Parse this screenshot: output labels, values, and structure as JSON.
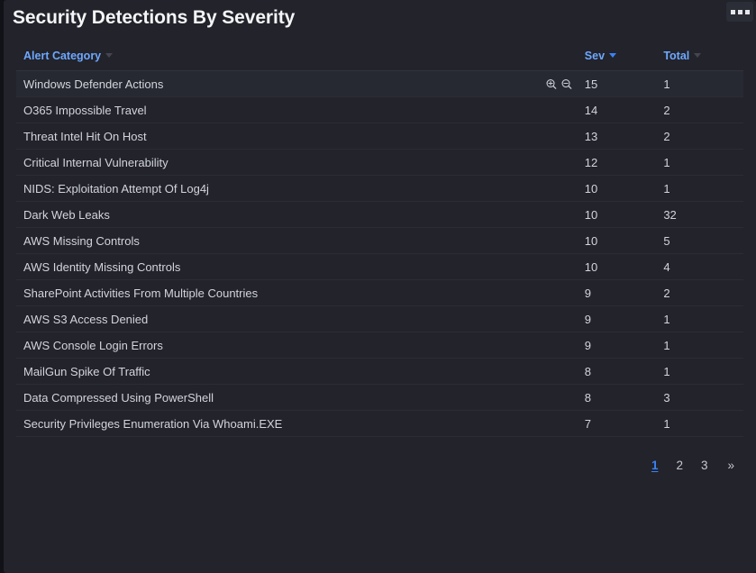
{
  "panel": {
    "title": "Security Detections By Severity",
    "menu_icon": "ellipsis-horizontal-icon"
  },
  "table": {
    "columns": [
      {
        "key": "category",
        "label": "Alert Category",
        "sort": "none"
      },
      {
        "key": "sev",
        "label": "Sev",
        "sort": "desc"
      },
      {
        "key": "total",
        "label": "Total",
        "sort": "none"
      }
    ],
    "row_icons": {
      "zoom_in": "zoom-in-icon",
      "zoom_out": "zoom-out-icon"
    },
    "rows": [
      {
        "category": "Windows Defender Actions",
        "sev": "15",
        "total": "1",
        "hovered": true
      },
      {
        "category": "O365 Impossible Travel",
        "sev": "14",
        "total": "2",
        "hovered": false
      },
      {
        "category": "Threat Intel Hit On Host",
        "sev": "13",
        "total": "2",
        "hovered": false
      },
      {
        "category": "Critical Internal Vulnerability",
        "sev": "12",
        "total": "1",
        "hovered": false
      },
      {
        "category": "NIDS: Exploitation Attempt Of Log4j",
        "sev": "10",
        "total": "1",
        "hovered": false
      },
      {
        "category": "Dark Web Leaks",
        "sev": "10",
        "total": "32",
        "hovered": false
      },
      {
        "category": "AWS Missing Controls",
        "sev": "10",
        "total": "5",
        "hovered": false
      },
      {
        "category": "AWS Identity Missing Controls",
        "sev": "10",
        "total": "4",
        "hovered": false
      },
      {
        "category": "SharePoint Activities From Multiple Countries",
        "sev": "9",
        "total": "2",
        "hovered": false
      },
      {
        "category": "AWS S3 Access Denied",
        "sev": "9",
        "total": "1",
        "hovered": false
      },
      {
        "category": "AWS Console Login Errors",
        "sev": "9",
        "total": "1",
        "hovered": false
      },
      {
        "category": "MailGun Spike Of Traffic",
        "sev": "8",
        "total": "1",
        "hovered": false
      },
      {
        "category": "Data Compressed Using PowerShell",
        "sev": "8",
        "total": "3",
        "hovered": false
      },
      {
        "category": "Security Privileges Enumeration Via Whoami.EXE",
        "sev": "7",
        "total": "1",
        "hovered": false
      }
    ]
  },
  "pagination": {
    "pages": [
      "1",
      "2",
      "3"
    ],
    "current": "1",
    "next_label": "»"
  },
  "colors": {
    "panel_background": "#22232b",
    "page_background": "#111217",
    "accent_blue": "#3b82f6",
    "header_blue": "#6ea8fe",
    "row_text": "#d3d5db",
    "row_hover": "#272932",
    "row_divider": "#2b2d35"
  }
}
